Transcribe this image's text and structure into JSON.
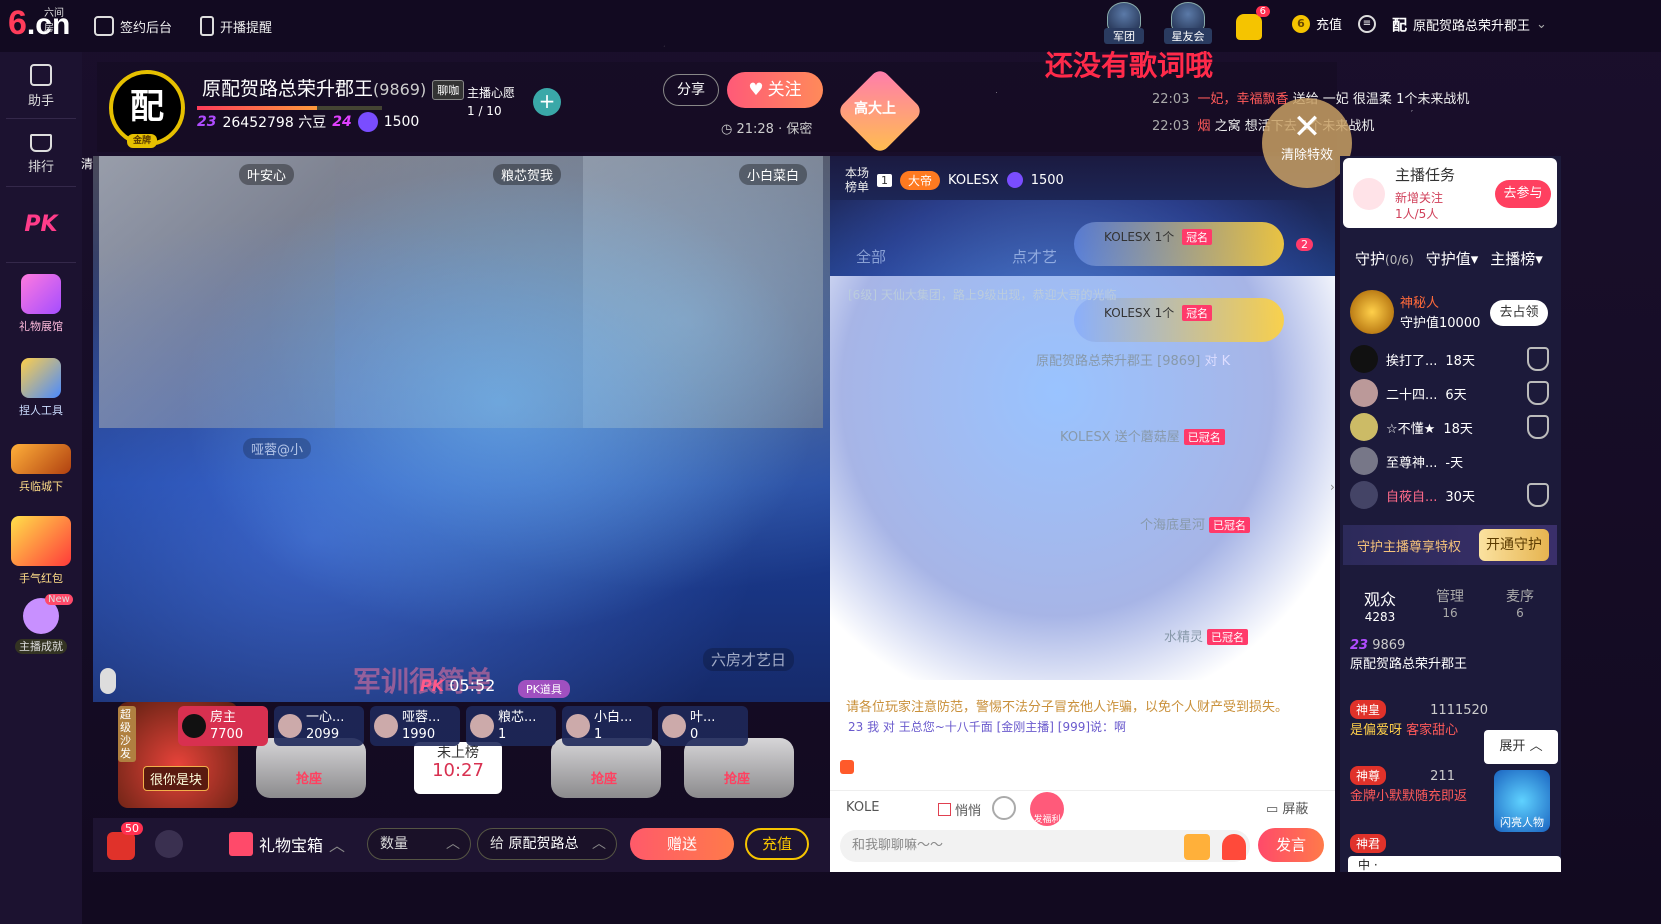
{
  "topbar": {
    "logo_six": "6",
    "logo_cn": ".cn",
    "logo_sub": "六间房",
    "nav": [
      {
        "label": "签约后台",
        "icon": "document-icon"
      },
      {
        "label": "开播提醒",
        "icon": "phone-icon"
      }
    ],
    "legion_label": "军团",
    "starclub_label": "星友会",
    "bell_count": "6",
    "coin_glyph": "6",
    "recharge_label": "充值",
    "user_avatar_glyph": "配",
    "username": "原配贺路总荣升郡王"
  },
  "sidebar": {
    "items": [
      {
        "label": "助手"
      },
      {
        "label": "排行"
      },
      {
        "label": "PK"
      },
      {
        "label": "礼物展馆"
      },
      {
        "label": "捏人工具"
      },
      {
        "label": "兵临城下"
      },
      {
        "label": "手气红包"
      },
      {
        "label": "主播成就",
        "badge": "New"
      }
    ]
  },
  "header": {
    "avatar_glyph": "配",
    "avatar_badge": "金牌",
    "name": "原配贺路总荣升郡王",
    "id": "(9869)",
    "chat_badge": "聊咖",
    "level": "23",
    "beans": "26452798 六豆",
    "level2": "24",
    "points": "1500",
    "progress": 0.65,
    "wish_label": "主播心愿",
    "wish_value": "1 / 10",
    "share_label": "分享",
    "follow_label": "关注",
    "time": "21:28",
    "location": "保密",
    "gaoda_label": "高大上"
  },
  "lyric": "还没有歌词哦",
  "gift_log": [
    {
      "time": "22:03",
      "text": "一妃，幸福飘香",
      "mid": "送给 一妃",
      "gift": "很温柔",
      "tail": "1个未来战机"
    },
    {
      "time": "22:03",
      "text": "烟",
      "mid": "之窝",
      "gift": "想活下去",
      "tail": "1个未来战机"
    }
  ],
  "clear_effects_label": "清除特效",
  "stage": {
    "side_label": "清",
    "videos": [
      {
        "name": "叶安心"
      },
      {
        "name": "粮芯贺我"
      },
      {
        "name": "小白菜白"
      }
    ],
    "lower_labels": [
      "哑蓉@小",
      "六房才艺日"
    ],
    "watermark": "军训很简单",
    "pk_timer": "05:52",
    "pk_label": "PK道具",
    "pk_glyph": "PK",
    "seats": [
      {
        "name": "房主",
        "score": "7700"
      },
      {
        "name": "一心...",
        "score": "2099"
      },
      {
        "name": "哑蓉...",
        "score": "1990"
      },
      {
        "name": "粮芯...",
        "score": "1"
      },
      {
        "name": "小白...",
        "score": "1"
      },
      {
        "name": "叶...",
        "score": "0"
      }
    ],
    "sofa_vertical": "超级沙发",
    "sofa_tag": "很你是块",
    "grab_label": "抢座",
    "not_on_board": "未上榜",
    "not_on_board_time": "10:27"
  },
  "bottombar": {
    "red_badge": "50",
    "gift_box_label": "礼物宝箱",
    "qty_label": "数量",
    "to_label": "给",
    "to_name": "原配贺路总",
    "send_label": "赠送",
    "recharge_label": "充值"
  },
  "chat": {
    "rank_label": "本场",
    "rank_label2": "榜单",
    "rank_num": "1",
    "dadi": "大帝",
    "top_user": "KOLESX",
    "top_points": "1500",
    "tabs": [
      "全部",
      "点才艺"
    ],
    "crown_user": "KOLESX",
    "crown_count": "1个",
    "crown_tag": "冠名",
    "bubble_count": "2",
    "lines": [
      {
        "text": "[6级] 天仙大集团，路上9级出现，恭迎大哥的光临"
      },
      {
        "text": "原配贺路总荣升郡王 [9869]",
        "tail": "对 K"
      },
      {
        "text": "KOLESX 送个蘑菇屋",
        "tag": "已冠名"
      },
      {
        "text": "个海底星河",
        "tag": "已冠名"
      },
      {
        "text": "水精灵",
        "tag": "已冠名"
      }
    ],
    "warning": "请各位玩家注意防范，警惕不法分子冒充他人诈骗，以免个人财产受到损失。",
    "sub_line": "23 我 对 王总您~十八千面 [金刚主播] [999]说：啊",
    "input_user": "KOLE",
    "quiet_label": "悄悄",
    "shield_label": "屏蔽",
    "input_placeholder": "和我聊聊嘛～～",
    "speak_label": "发言",
    "redpack_label": "发福利"
  },
  "right": {
    "task_title": "主播任务",
    "task_sub1": "新增关注",
    "task_sub2": "1人/5人",
    "task_btn": "去参与",
    "tabs": [
      {
        "label": "守护",
        "sub": "(0/6)"
      },
      {
        "label": "守护值▾",
        "sub": ""
      },
      {
        "label": "主播榜▾",
        "sub": ""
      }
    ],
    "mystery_name": "神秘人",
    "mystery_value": "守护值10000",
    "mystery_btn": "去占领",
    "guards": [
      {
        "name": "挨打了...",
        "days": "18天"
      },
      {
        "name": "二十四...",
        "days": "6天"
      },
      {
        "name": "☆不懂★",
        "days": "18天"
      },
      {
        "name": "至尊神...",
        "days": "-天"
      },
      {
        "name": "自莜自...",
        "days": "30天"
      }
    ],
    "guard_text": "守护主播尊享特权",
    "guard_btn": "开通守护",
    "aud_tabs": [
      {
        "label": "观众",
        "count": "4283"
      },
      {
        "label": "管理",
        "count": "16"
      },
      {
        "label": "麦序",
        "count": "6"
      }
    ],
    "entries": [
      {
        "level": "23",
        "id": "9869",
        "name": "原配贺路总荣升郡王"
      },
      {
        "tag": "神皇",
        "num": "1111520",
        "name": "是偏爱呀",
        "sub": "客家甜心"
      },
      {
        "tag": "神尊",
        "num": "211",
        "name": "金牌小默默随充即返"
      },
      {
        "tag": "神君",
        "num": ""
      }
    ],
    "expand_label": "展开",
    "flash_label": "闪亮人物",
    "taskbar": "中 ·"
  }
}
